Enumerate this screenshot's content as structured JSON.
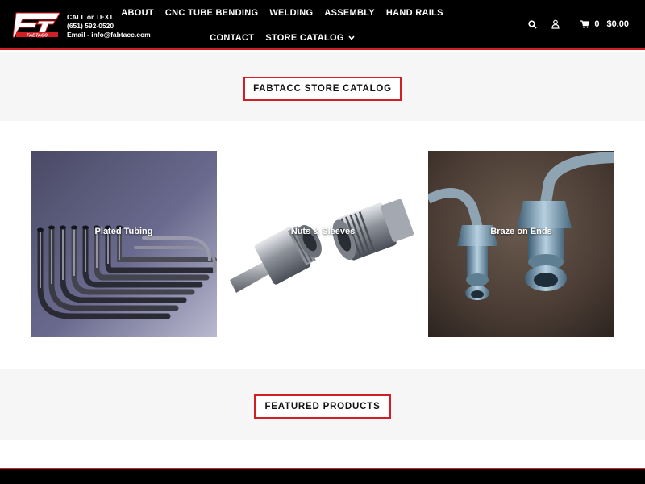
{
  "header": {
    "logo_text": "FT",
    "logo_subtext": "FABTACC",
    "contact": {
      "line1": "CALL or TEXT",
      "phone": "(651) 592-0520",
      "email": "Email - info@fabtacc.com"
    },
    "nav_row1": [
      "ABOUT",
      "CNC TUBE BENDING",
      "WELDING",
      "ASSEMBLY",
      "HAND RAILS"
    ],
    "nav_row2": [
      "CONTACT",
      "STORE CATALOG"
    ],
    "cart": {
      "count": "0",
      "total": "$0.00"
    },
    "icons": [
      "search-icon",
      "user-icon",
      "cart-icon",
      "chevron-down-icon"
    ]
  },
  "catalog": {
    "title": "FABTACC STORE CATALOG",
    "tiles": [
      {
        "label": "Plated Tubing"
      },
      {
        "label": "Nuts & Sleeves"
      },
      {
        "label": "Braze on Ends"
      }
    ]
  },
  "featured": {
    "title": "FEATURED PRODUCTS"
  },
  "colors": {
    "accent": "#d21f26",
    "header_bg": "#000000",
    "band_bg": "#f6f6f6"
  }
}
